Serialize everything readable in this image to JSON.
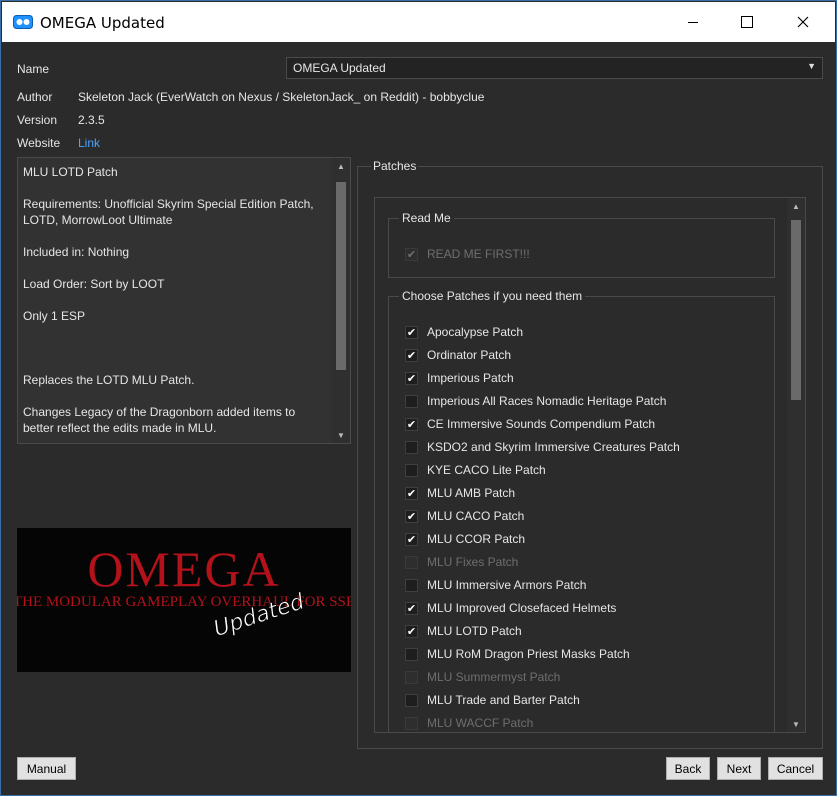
{
  "window": {
    "title": "OMEGA Updated",
    "controls": {
      "minimize": "–",
      "maximize": "☐",
      "close": "✕"
    }
  },
  "info": {
    "name_label": "Name",
    "name_value": "OMEGA Updated",
    "author_label": "Author",
    "author_value": "Skeleton Jack (EverWatch on Nexus / SkeletonJack_ on Reddit) - bobbyclue",
    "version_label": "Version",
    "version_value": "2.3.5",
    "website_label": "Website",
    "website_link": "Link"
  },
  "description": {
    "lines": [
      "MLU LOTD Patch",
      "Requirements: Unofficial Skyrim Special Edition Patch, LOTD, MorrowLoot Ultimate",
      "Included in: Nothing",
      "Load Order: Sort by LOOT",
      "Only 1 ESP",
      "",
      "Replaces the LOTD MLU Patch.",
      "Changes Legacy of the Dragonborn added items to better reflect the edits made in MLU."
    ],
    "scroll_fraction": 0.7
  },
  "banner": {
    "title": "OMEGA",
    "subtitle": "THE MODULAR GAMEPLAY OVERHAUL FOR SSE",
    "badge": "Updated"
  },
  "patches": {
    "title": "Patches",
    "groups": [
      {
        "title": "Read Me",
        "options": [
          {
            "label": "READ ME FIRST!!!",
            "checked": true,
            "disabled": true
          }
        ]
      },
      {
        "title": "Choose Patches if you need them",
        "options": [
          {
            "label": "Apocalypse Patch",
            "checked": true,
            "disabled": false
          },
          {
            "label": "Ordinator Patch",
            "checked": true,
            "disabled": false
          },
          {
            "label": "Imperious Patch",
            "checked": true,
            "disabled": false
          },
          {
            "label": "Imperious All Races Nomadic Heritage Patch",
            "checked": false,
            "disabled": false
          },
          {
            "label": "CE Immersive Sounds Compendium Patch",
            "checked": true,
            "disabled": false
          },
          {
            "label": "KSDO2 and Skyrim Immersive Creatures Patch",
            "checked": false,
            "disabled": false
          },
          {
            "label": "KYE CACO Lite Patch",
            "checked": false,
            "disabled": false
          },
          {
            "label": "MLU AMB Patch",
            "checked": true,
            "disabled": false
          },
          {
            "label": "MLU CACO Patch",
            "checked": true,
            "disabled": false
          },
          {
            "label": "MLU CCOR Patch",
            "checked": true,
            "disabled": false
          },
          {
            "label": "MLU Fixes Patch",
            "checked": false,
            "disabled": true
          },
          {
            "label": "MLU Immersive Armors Patch",
            "checked": false,
            "disabled": false
          },
          {
            "label": "MLU Improved Closefaced Helmets",
            "checked": true,
            "disabled": false
          },
          {
            "label": "MLU LOTD Patch",
            "checked": true,
            "disabled": false
          },
          {
            "label": "MLU RoM Dragon Priest Masks Patch",
            "checked": false,
            "disabled": false
          },
          {
            "label": "MLU Summermyst Patch",
            "checked": false,
            "disabled": true
          },
          {
            "label": "MLU Trade and Barter Patch",
            "checked": false,
            "disabled": false
          },
          {
            "label": "MLU WACCF Patch",
            "checked": false,
            "disabled": true
          }
        ]
      }
    ]
  },
  "buttons": {
    "manual": "Manual",
    "back": "Back",
    "next": "Next",
    "cancel": "Cancel"
  },
  "colors": {
    "background": "#2b2b2b",
    "link": "#4aa3ff",
    "banner_red": "#b3121a"
  }
}
